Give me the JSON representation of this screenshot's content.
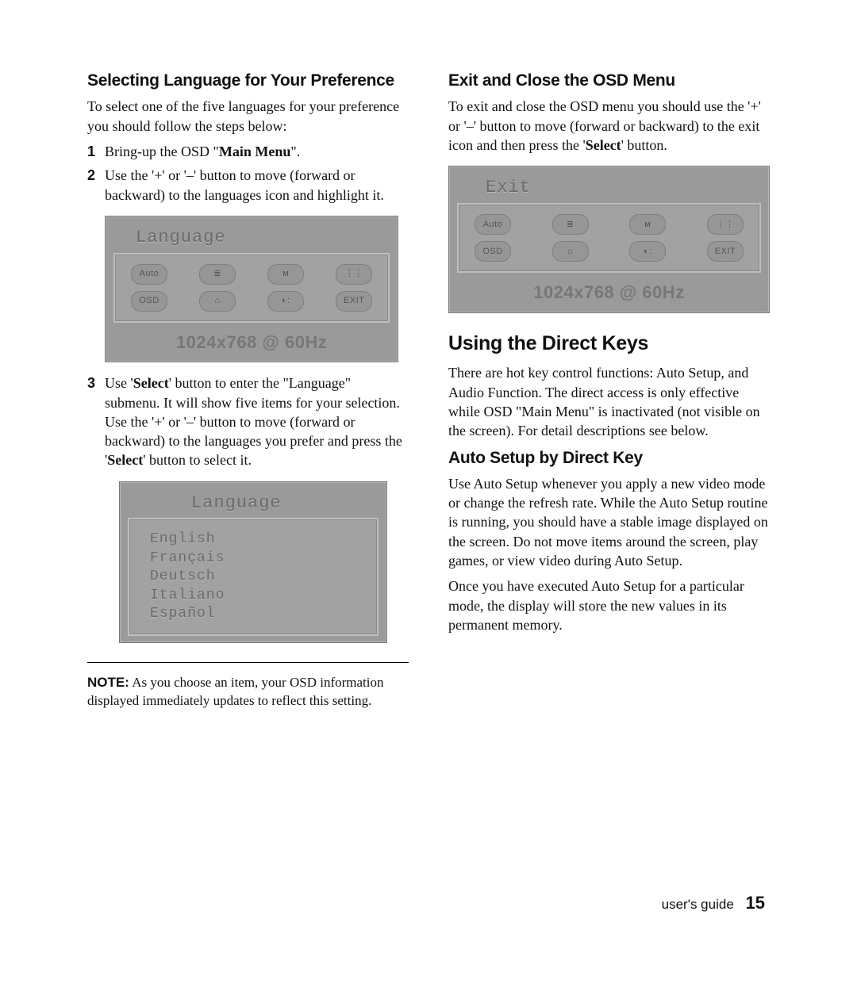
{
  "left": {
    "h1": "Selecting Language for Your Preference",
    "intro": "To select one of the five languages for your preference you should follow the steps below:",
    "steps": {
      "s1_num": "1",
      "s1": "Bring-up the OSD \"",
      "s1_b": "Main Menu",
      "s1_end": "\".",
      "s2_num": "2",
      "s2": "Use the '+' or '–' button to move (forward or backward) to the languages icon and highlight it.",
      "s3_num": "3",
      "s3a": "Use '",
      "s3b": "Select",
      "s3c": "' button to enter the \"Language\" submenu. It will show five items for your selection. Use the '+' or '–' button to move (forward or backward) to the languages you prefer and press the '",
      "s3d": "Select",
      "s3e": "' button to select it."
    },
    "osd1": {
      "title": "Language",
      "row1": [
        "Auto",
        "≣",
        "ᴍ",
        "⋮⋮"
      ],
      "row2": [
        "OSD",
        "⌂",
        "◐:",
        "EXIT"
      ],
      "res": "1024x768 @ 60Hz"
    },
    "osd2": {
      "title": "Language",
      "items": [
        "English",
        "Français",
        "Deutsch",
        "Italiano",
        "Español"
      ]
    },
    "note_label": "NOTE:",
    "note": " As you choose an item, your OSD information displayed immediately updates to reflect this setting."
  },
  "right": {
    "h1": "Exit and Close the OSD Menu",
    "p1a": "To exit and close the OSD menu you should use the '+' or '–' button to move (forward or backward) to the exit icon and then press the '",
    "p1b": "Select",
    "p1c": "' button.",
    "osd": {
      "title": "Exit",
      "row1": [
        "Auto",
        "≣",
        "ᴍ",
        "⋮⋮"
      ],
      "row2": [
        "OSD",
        "⌂",
        "◐:",
        "EXIT"
      ],
      "res": "1024x768 @ 60Hz"
    },
    "h2": "Using the Direct Keys",
    "p2": "There are hot key control functions: Auto Setup, and Audio Function. The direct access is only effective while OSD \"Main Menu\" is inactivated (not visible on the screen).  For detail descriptions see below.",
    "h3": "Auto Setup by Direct Key",
    "p3": "Use Auto Setup whenever you apply a new video mode or change the refresh rate. While the Auto Setup routine is running, you should have a stable image displayed on the screen. Do not move items around the screen, play games, or view video during Auto Setup.",
    "p4": "Once you have executed Auto Setup for a particular mode, the display will store the new values in its permanent memory."
  },
  "footer": {
    "label": "user's guide",
    "page": "15"
  }
}
